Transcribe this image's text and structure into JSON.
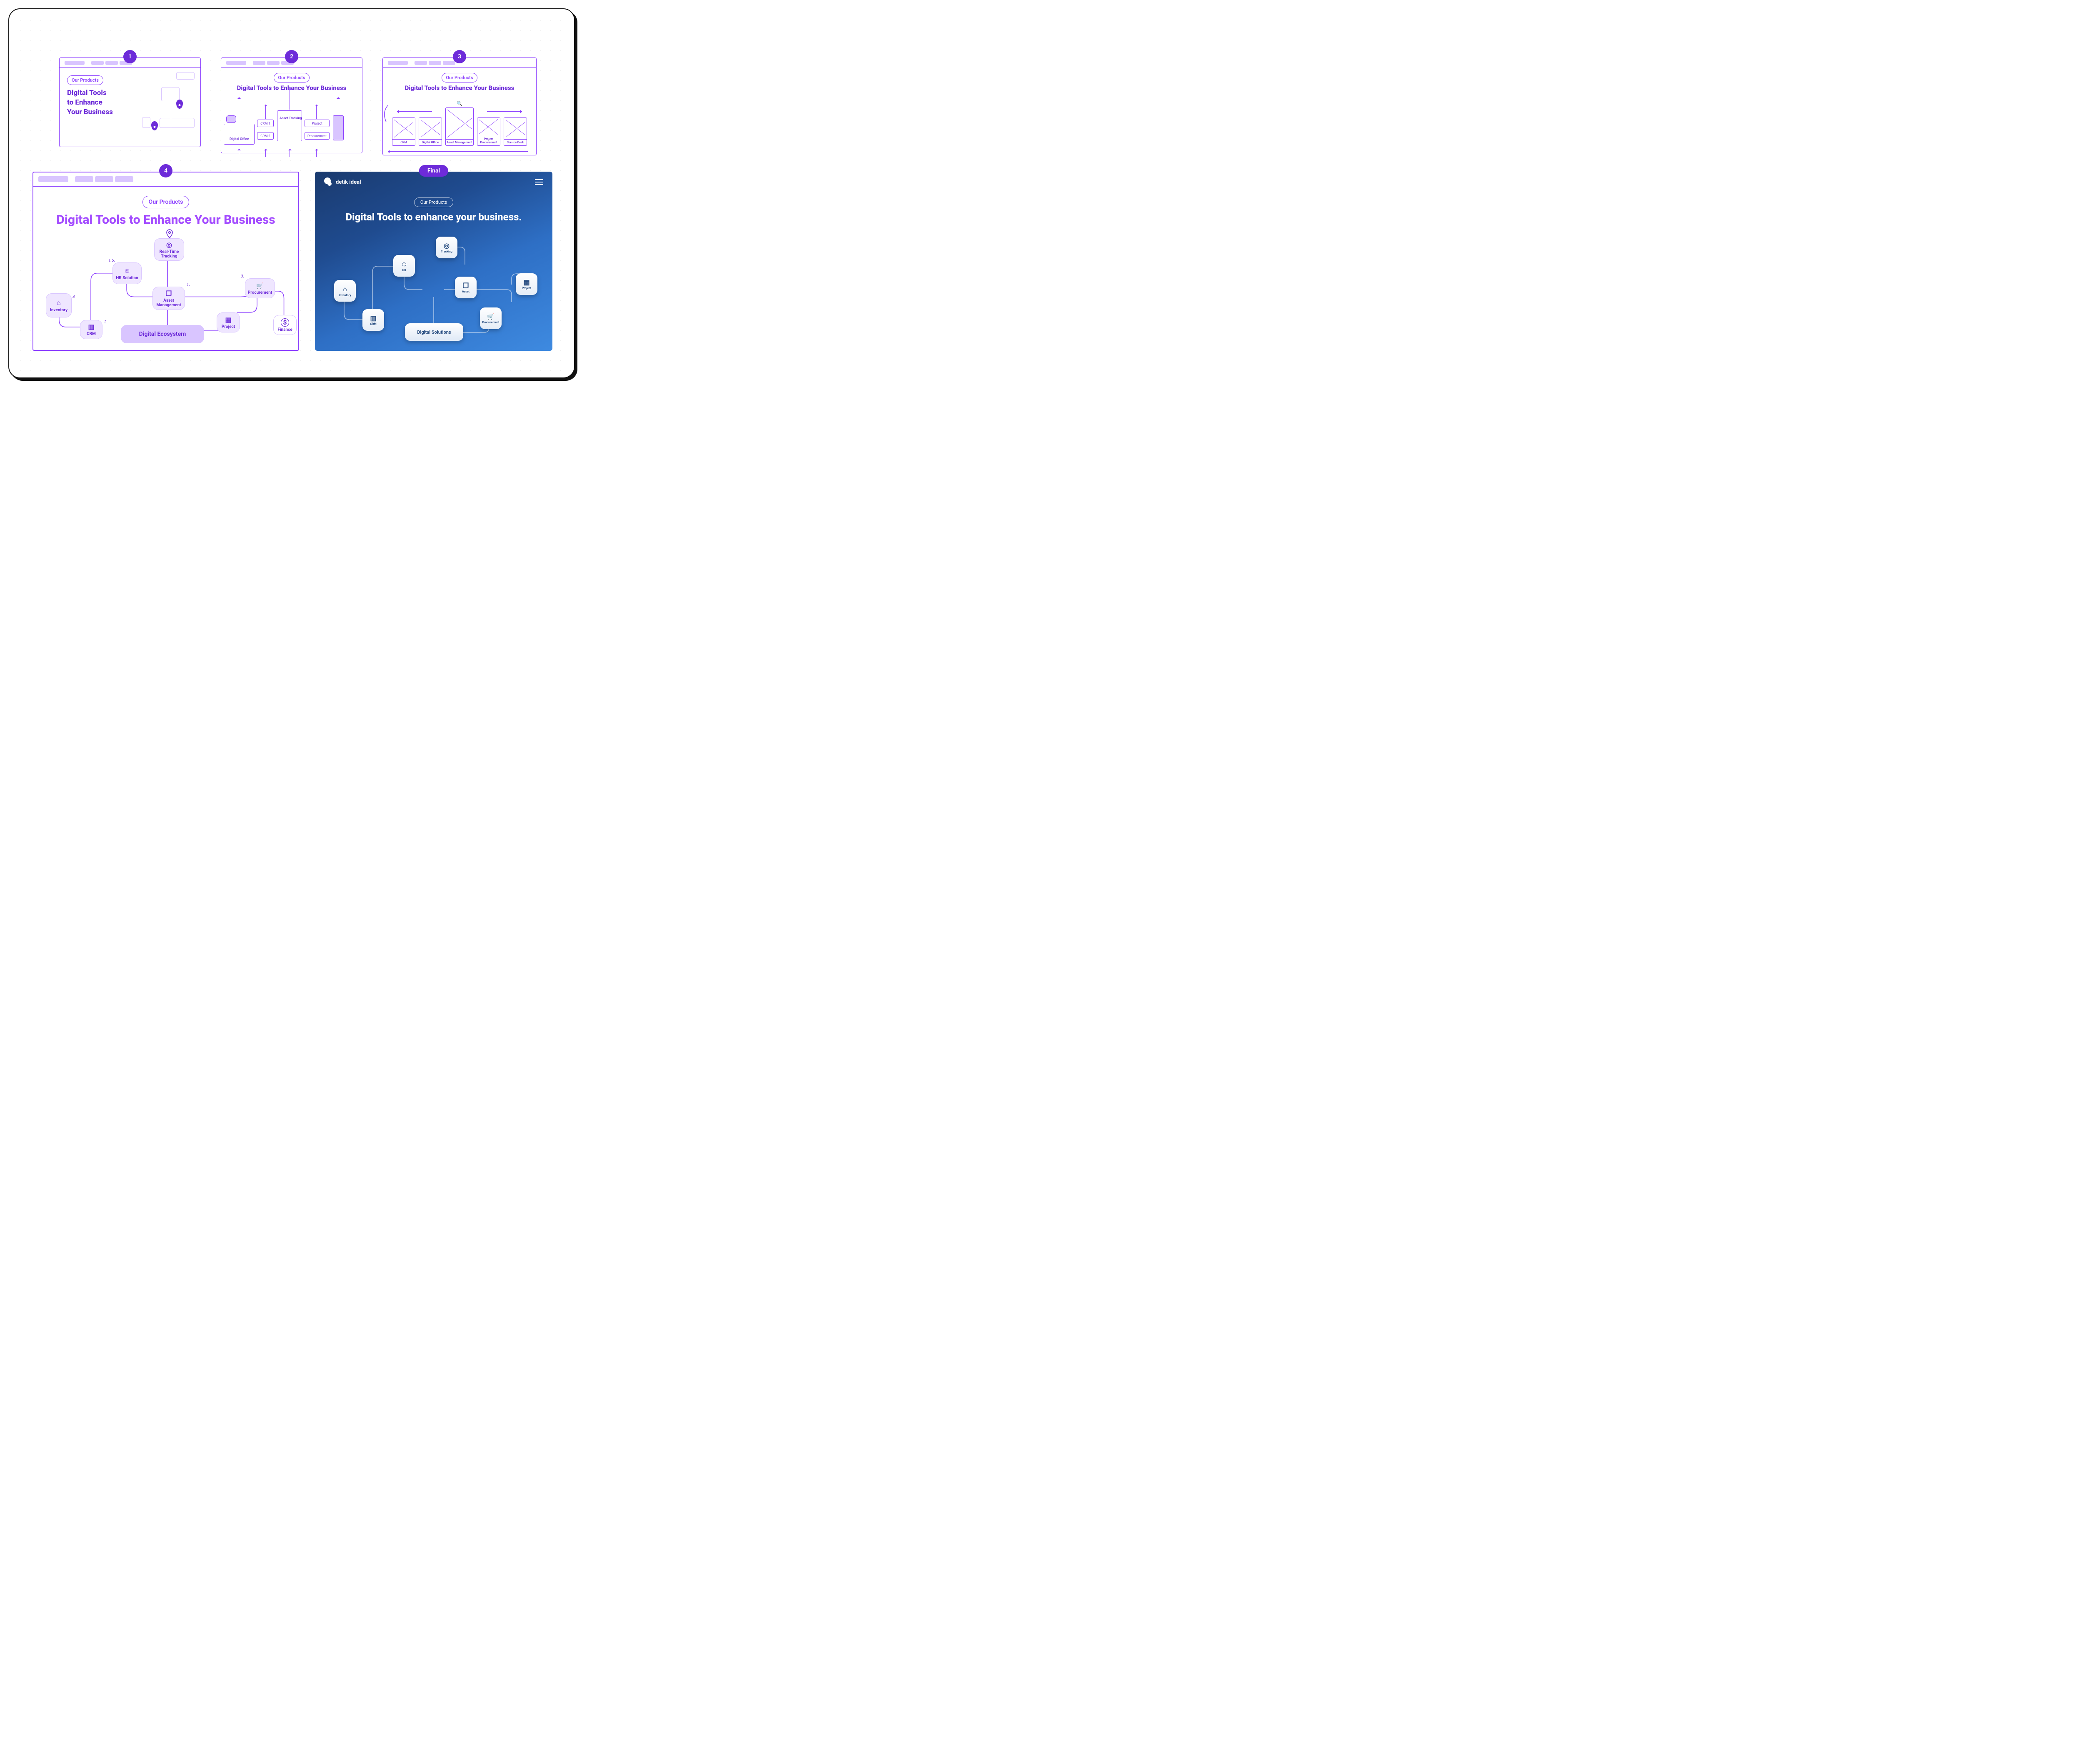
{
  "steps": {
    "s1": {
      "badge": "1",
      "tag": "Our Products",
      "l1": "Digital Tools",
      "l2": "to Enhance",
      "l3": "Your Business"
    },
    "s2": {
      "badge": "2",
      "tag": "Our Products",
      "title": "Digital Tools to Enhance Your Business",
      "digital_office": "Digital Office",
      "crm1": "CRM 1",
      "crm2": "CRM 2",
      "asset": "Asset Tracking",
      "project": "Project",
      "procurement": "Procurement"
    },
    "s3": {
      "badge": "3",
      "tag": "Our Products",
      "title": "Digital Tools to Enhance Your Business",
      "cards": [
        "CRM",
        "Digital Office",
        "Asset Management",
        "Project Procurement",
        "Service Desk"
      ]
    },
    "s4": {
      "badge": "4",
      "tag": "Our Products",
      "title": "Digital Tools to Enhance Your Business",
      "notes": {
        "a": "1.",
        "b": "2.",
        "c": "3.",
        "d": "4.",
        "e": "1.5."
      },
      "nodes": {
        "inventory": "Inventory",
        "crm": "CRM",
        "hr": "HR Solution",
        "tracking": "Real-Time Tracking",
        "asset": "Asset Management",
        "project": "Project",
        "procurement": "Procurement",
        "finance": "Finance",
        "hub": "Digital Ecosystem"
      }
    },
    "final": {
      "badge": "Final",
      "brand": "detik ideal",
      "tag": "Our Products",
      "title": "Digital Tools to enhance your business.",
      "nodes": {
        "inventory": "Inventory",
        "crm": "CRM",
        "hr": "HR",
        "tracking": "Tracking",
        "asset": "Asset",
        "project": "Project",
        "procurement": "Procurement",
        "hub": "Digital Solutions"
      }
    }
  }
}
